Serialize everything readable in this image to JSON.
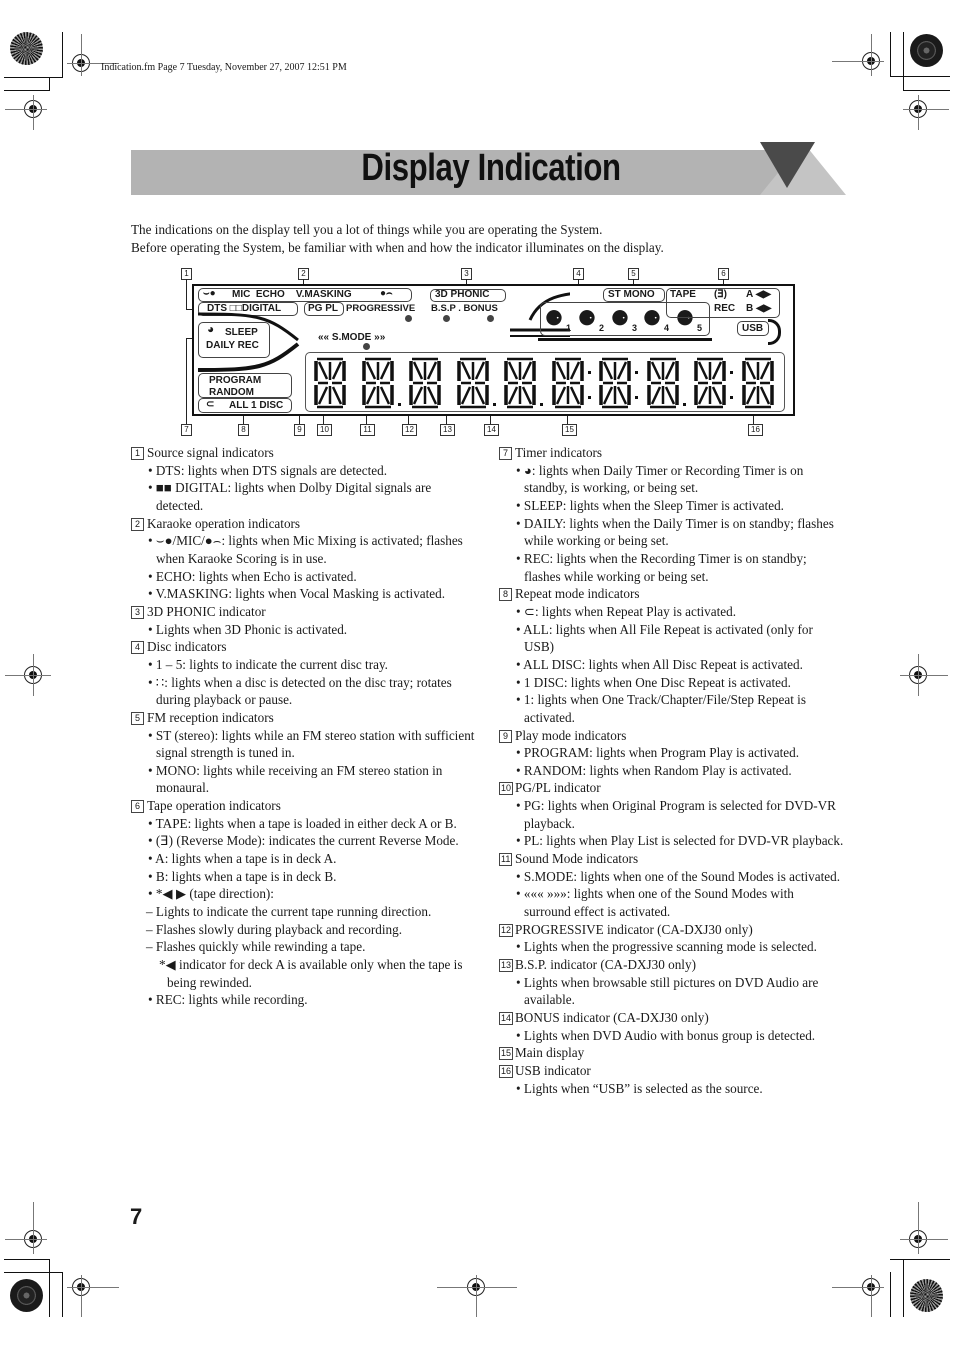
{
  "file_header": "Indication.fm  Page 7  Tuesday, November 27, 2007  12:51 PM",
  "title": "Display Indication",
  "intro": [
    "The indications on the display tell you a lot of things while you are operating the System.",
    "Before operating the System, be familiar with when and how the indicator illuminates on the display."
  ],
  "page_number": "7",
  "display": {
    "callouts": [
      "1",
      "2",
      "3",
      "4",
      "5",
      "6",
      "7",
      "8",
      "9",
      "10",
      "11",
      "12",
      "13",
      "14",
      "15",
      "16"
    ],
    "karaoke_row": "MIC  ECHO    V.MASKING",
    "dts_digital": "DTS □□DIGITAL",
    "pg_pl": "PG PL",
    "progressive": "PROGRESSIVE",
    "bsp_bonus": "B.S.P . BONUS",
    "phonic": "3D PHONIC",
    "st_mono": "ST MONO",
    "tape": "TAPE",
    "reverse": "(ⴺ)",
    "deck_a": "A ◀▶",
    "rec": "REC",
    "deck_b": "B ◀▶",
    "disc_numbers": [
      "1",
      "2",
      "3",
      "4",
      "5"
    ],
    "sleep": "SLEEP",
    "daily_rec": "DAILY REC",
    "smode": "«« S.MODE »»",
    "program": "PROGRAM",
    "random": "RANDOM",
    "all_disc": "ALL 1 DISC",
    "usb": "USB",
    "digits": 10
  },
  "left_column": [
    {
      "num": "1",
      "heading": "Source signal indicators",
      "items": [
        {
          "t": "b",
          "text": "• DTS: lights when DTS signals are detected."
        },
        {
          "t": "b",
          "text": "• ■■ DIGITAL: lights when Dolby Digital signals are detected."
        }
      ]
    },
    {
      "num": "2",
      "heading": "Karaoke operation indicators",
      "items": [
        {
          "t": "b",
          "text": "• ⌣●/MIC/●⌢: lights when Mic Mixing is activated; flashes when Karaoke Scoring is in use."
        },
        {
          "t": "b",
          "text": "• ECHO: lights when Echo is activated."
        },
        {
          "t": "b",
          "text": "• V.MASKING: lights when Vocal Masking is activated."
        }
      ]
    },
    {
      "num": "3",
      "heading": "3D PHONIC indicator",
      "items": [
        {
          "t": "b",
          "text": "• Lights when 3D Phonic is activated."
        }
      ]
    },
    {
      "num": "4",
      "heading": "Disc indicators",
      "items": [
        {
          "t": "b",
          "text": "• 1 – 5: lights to indicate the current disc tray."
        },
        {
          "t": "b",
          "text": "• ∷: lights when a disc is detected on the disc tray; rotates during playback or pause."
        }
      ]
    },
    {
      "num": "5",
      "heading": "FM reception indicators",
      "items": [
        {
          "t": "b",
          "text": "• ST (stereo): lights while an FM stereo station with sufficient signal strength is tuned in."
        },
        {
          "t": "b",
          "text": "• MONO: lights while receiving an FM stereo station in monaural."
        }
      ]
    },
    {
      "num": "6",
      "heading": "Tape operation indicators",
      "items": [
        {
          "t": "b",
          "text": "• TAPE: lights when a tape is loaded in either deck A or B."
        },
        {
          "t": "b",
          "text": "• (ⴺ) (Reverse Mode): indicates the current Reverse Mode."
        },
        {
          "t": "b",
          "text": "• A: lights when a tape is in deck A."
        },
        {
          "t": "b",
          "text": "• B: lights when a tape is in deck B."
        },
        {
          "t": "b",
          "text": "• *◀ ▶ (tape direction):"
        },
        {
          "t": "d",
          "text": "– Lights to indicate the current tape running direction."
        },
        {
          "t": "d",
          "text": "– Flashes slowly during playback and recording."
        },
        {
          "t": "d",
          "text": "– Flashes quickly while rewinding a tape."
        },
        {
          "t": "n",
          "text": "*◀ indicator for deck A is available only when the tape is being rewinded."
        },
        {
          "t": "b",
          "text": "• REC: lights while recording."
        }
      ]
    }
  ],
  "right_column": [
    {
      "num": "7",
      "heading": "Timer indicators",
      "items": [
        {
          "t": "b",
          "text": "• ◕: lights when Daily Timer or Recording Timer is on standby, is working, or being set."
        },
        {
          "t": "b",
          "text": "• SLEEP: lights when the Sleep Timer is activated."
        },
        {
          "t": "b",
          "text": "• DAILY: lights when the Daily Timer is on standby; flashes while working or being set."
        },
        {
          "t": "b",
          "text": "• REC: lights when the Recording Timer is on standby; flashes while working or being set."
        }
      ]
    },
    {
      "num": "8",
      "heading": "Repeat mode indicators",
      "items": [
        {
          "t": "b",
          "text": "• ⊂: lights when Repeat Play is activated."
        },
        {
          "t": "b",
          "text": "• ALL: lights when All File Repeat is activated (only for USB)"
        },
        {
          "t": "b",
          "text": "• ALL DISC: lights when All Disc Repeat is activated."
        },
        {
          "t": "b",
          "text": "• 1 DISC: lights when One Disc Repeat is activated."
        },
        {
          "t": "b",
          "text": "• 1: lights when One Track/Chapter/File/Step Repeat is activated."
        }
      ]
    },
    {
      "num": "9",
      "heading": "Play mode indicators",
      "items": [
        {
          "t": "b",
          "text": "• PROGRAM: lights when Program Play is activated."
        },
        {
          "t": "b",
          "text": "• RANDOM: lights when Random Play is activated."
        }
      ]
    },
    {
      "num": "10",
      "heading": "PG/PL indicator",
      "items": [
        {
          "t": "b",
          "text": "• PG: lights when Original Program is selected for DVD-VR playback."
        },
        {
          "t": "b",
          "text": "• PL: lights when Play List is selected for DVD-VR playback."
        }
      ]
    },
    {
      "num": "11",
      "heading": "Sound Mode indicators",
      "items": [
        {
          "t": "b",
          "text": "• S.MODE: lights when one of the Sound Modes is activated."
        },
        {
          "t": "b",
          "text": "• «««         »»»: lights when one of the Sound Modes with surround effect is activated."
        }
      ]
    },
    {
      "num": "12",
      "heading": "PROGRESSIVE indicator (CA-DXJ30 only)",
      "items": [
        {
          "t": "b",
          "text": "• Lights when the progressive scanning mode is selected."
        }
      ]
    },
    {
      "num": "13",
      "heading": "B.S.P. indicator (CA-DXJ30 only)",
      "items": [
        {
          "t": "b",
          "text": "• Lights when browsable still pictures on DVD Audio are available."
        }
      ]
    },
    {
      "num": "14",
      "heading": "BONUS indicator (CA-DXJ30 only)",
      "items": [
        {
          "t": "b",
          "text": "• Lights when DVD Audio with bonus group is detected."
        }
      ]
    },
    {
      "num": "15",
      "heading": "Main display",
      "items": []
    },
    {
      "num": "16",
      "heading": "USB indicator",
      "items": [
        {
          "t": "b",
          "text": "• Lights when “USB” is selected as the source."
        }
      ]
    }
  ]
}
